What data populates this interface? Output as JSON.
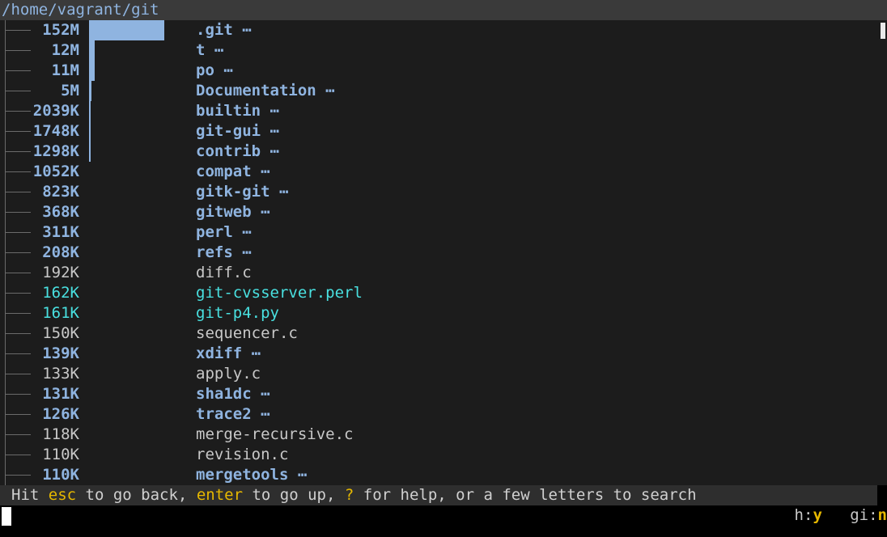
{
  "title": "/home/vagrant/git",
  "entries": [
    {
      "size": "152M",
      "name": ".git",
      "ellipsis": "⋯",
      "kind": "dir",
      "bar_fraction": 1.0
    },
    {
      "size": "12M",
      "name": "t",
      "ellipsis": "⋯",
      "kind": "dir",
      "bar_fraction": 0.079
    },
    {
      "size": "11M",
      "name": "po",
      "ellipsis": "⋯",
      "kind": "dir",
      "bar_fraction": 0.072
    },
    {
      "size": "5M",
      "name": "Documentation",
      "ellipsis": "⋯",
      "kind": "dir",
      "bar_fraction": 0.033
    },
    {
      "size": "2039K",
      "name": "builtin",
      "ellipsis": "⋯",
      "kind": "dir",
      "bar_fraction": 0.013
    },
    {
      "size": "1748K",
      "name": "git-gui",
      "ellipsis": "⋯",
      "kind": "dir",
      "bar_fraction": 0.011
    },
    {
      "size": "1298K",
      "name": "contrib",
      "ellipsis": "⋯",
      "kind": "dir",
      "bar_fraction": 0.008
    },
    {
      "size": "1052K",
      "name": "compat",
      "ellipsis": "⋯",
      "kind": "dir",
      "bar_fraction": 0
    },
    {
      "size": "823K",
      "name": "gitk-git",
      "ellipsis": "⋯",
      "kind": "dir",
      "bar_fraction": 0
    },
    {
      "size": "368K",
      "name": "gitweb",
      "ellipsis": "⋯",
      "kind": "dir",
      "bar_fraction": 0
    },
    {
      "size": "311K",
      "name": "perl",
      "ellipsis": "⋯",
      "kind": "dir",
      "bar_fraction": 0
    },
    {
      "size": "208K",
      "name": "refs",
      "ellipsis": "⋯",
      "kind": "dir",
      "bar_fraction": 0
    },
    {
      "size": "192K",
      "name": "diff.c",
      "ellipsis": "",
      "kind": "file",
      "bar_fraction": 0
    },
    {
      "size": "162K",
      "name": "git-cvsserver.perl",
      "ellipsis": "",
      "kind": "exec",
      "bar_fraction": 0
    },
    {
      "size": "161K",
      "name": "git-p4.py",
      "ellipsis": "",
      "kind": "exec",
      "bar_fraction": 0
    },
    {
      "size": "150K",
      "name": "sequencer.c",
      "ellipsis": "",
      "kind": "file",
      "bar_fraction": 0
    },
    {
      "size": "139K",
      "name": "xdiff",
      "ellipsis": "⋯",
      "kind": "dir",
      "bar_fraction": 0
    },
    {
      "size": "133K",
      "name": "apply.c",
      "ellipsis": "",
      "kind": "file",
      "bar_fraction": 0
    },
    {
      "size": "131K",
      "name": "sha1dc",
      "ellipsis": "⋯",
      "kind": "dir",
      "bar_fraction": 0
    },
    {
      "size": "126K",
      "name": "trace2",
      "ellipsis": "⋯",
      "kind": "dir",
      "bar_fraction": 0
    },
    {
      "size": "118K",
      "name": "merge-recursive.c",
      "ellipsis": "",
      "kind": "file",
      "bar_fraction": 0
    },
    {
      "size": "110K",
      "name": "revision.c",
      "ellipsis": "",
      "kind": "file",
      "bar_fraction": 0
    },
    {
      "size": "110K",
      "name": "mergetools",
      "ellipsis": "⋯",
      "kind": "dir",
      "bar_fraction": 0
    }
  ],
  "status": {
    "p1": "Hit ",
    "k1": "esc",
    "p2": " to go back, ",
    "k2": "enter",
    "p3": " to go up, ",
    "k3": "?",
    "p4": " for help, or a few letters to search"
  },
  "flags": {
    "h_label": "h:",
    "h_value": "y",
    "gi_label": "gi:",
    "gi_value": "n"
  },
  "colors": {
    "dir": "#8fb4e0",
    "file": "#c8c8c8",
    "exec": "#49e0e0",
    "key": "#e6b800"
  }
}
